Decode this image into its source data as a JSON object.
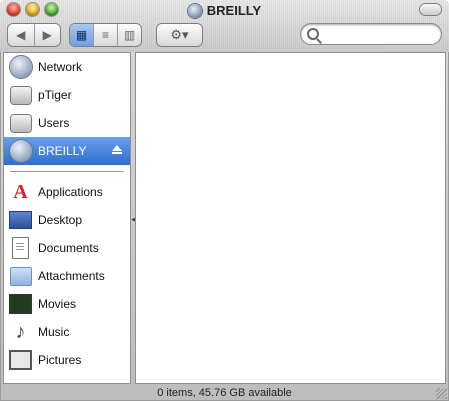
{
  "window": {
    "title": "BREILLY"
  },
  "toolbar": {
    "back_glyph": "◀",
    "forward_glyph": "▶",
    "views": [
      {
        "name": "icon-view",
        "glyph": "▦",
        "active": true
      },
      {
        "name": "list-view",
        "glyph": "≡",
        "active": false
      },
      {
        "name": "column-view",
        "glyph": "▥",
        "active": false
      }
    ],
    "action_glyph": "⚙▾",
    "search_placeholder": ""
  },
  "sidebar": {
    "devices": [
      {
        "label": "Network",
        "icon": "network-globe-icon"
      },
      {
        "label": "pTiger",
        "icon": "hard-disk-icon"
      },
      {
        "label": "Users",
        "icon": "hard-disk-icon"
      },
      {
        "label": "BREILLY",
        "icon": "network-volume-icon",
        "selected": true
      }
    ],
    "places": [
      {
        "label": "Applications",
        "icon": "applications-icon"
      },
      {
        "label": "Desktop",
        "icon": "desktop-icon"
      },
      {
        "label": "Documents",
        "icon": "documents-icon"
      },
      {
        "label": "Attachments",
        "icon": "folder-icon"
      },
      {
        "label": "Movies",
        "icon": "movies-icon"
      },
      {
        "label": "Music",
        "icon": "music-icon"
      },
      {
        "label": "Pictures",
        "icon": "pictures-icon"
      }
    ]
  },
  "status": {
    "text": "0 items, 45.76 GB available"
  },
  "colors": {
    "selection": "#2f6ccd",
    "close": "#e0382a",
    "minimize": "#e3a512",
    "zoom": "#3ea32a"
  }
}
